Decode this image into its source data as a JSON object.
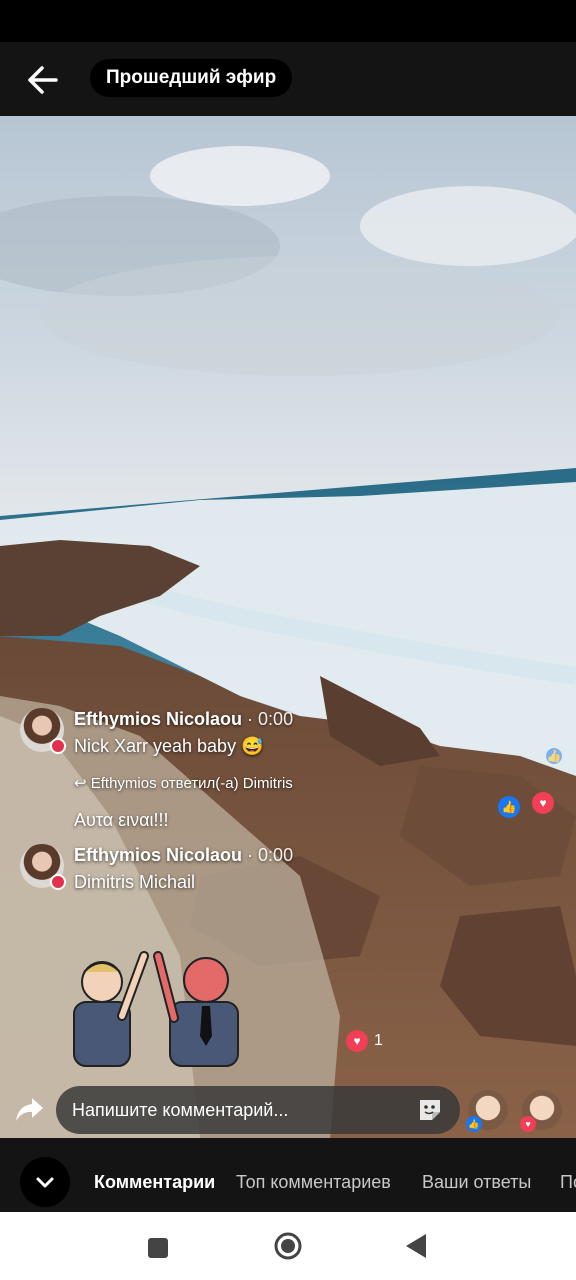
{
  "header": {
    "title": "Прошедший эфир",
    "back_icon": "arrow-left-icon"
  },
  "comments": [
    {
      "name": "Efthymios Nicolaou",
      "time": "0:00",
      "text": "Nick Xarr yeah baby 😅"
    },
    {
      "name": "Efthymios Nicolaou",
      "time": "0:00",
      "text": "Dimitris Michail"
    }
  ],
  "reply": {
    "label": "Efthymios ответил(-а) Dimitris",
    "text": "Αυτα ειναι!!!"
  },
  "reactions": {
    "heart_count": "1"
  },
  "comment_input": {
    "placeholder": "Напишите комментарий..."
  },
  "tabs": [
    "Комментарии",
    "Топ комментариев",
    "Ваши ответы",
    "По"
  ],
  "colors": {
    "like": "#1877f2",
    "love": "#f33e58",
    "bar": "#141414"
  }
}
